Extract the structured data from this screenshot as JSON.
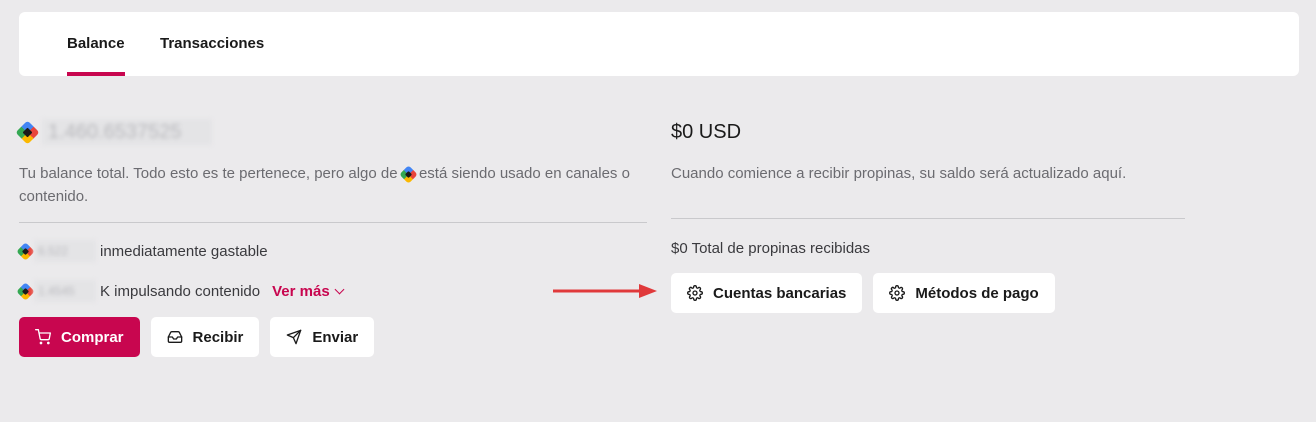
{
  "tabs": [
    {
      "label": "Balance",
      "active": true
    },
    {
      "label": "Transacciones",
      "active": false
    }
  ],
  "balance": {
    "amount": "1.460.6537525",
    "description_pre": "Tu balance total. Todo esto es te pertenece, pero algo de",
    "description_post": "está siendo usado en canales o contenido.",
    "spendable_amount": "6.522",
    "spendable_label": "inmediatamente gastable",
    "boosting_amount": "1.4545",
    "boosting_label": "K impulsando contenido",
    "ver_mas_label": "Ver más"
  },
  "actions": {
    "buy_label": "Comprar",
    "receive_label": "Recibir",
    "send_label": "Enviar"
  },
  "tips": {
    "amount": "$0 USD",
    "description": "Cuando comience a recibir propinas, su saldo será actualizado aquí.",
    "total_label": "$0 Total de propinas recibidas",
    "bank_accounts_label": "Cuentas bancarias",
    "payment_methods_label": "Métodos de pago"
  },
  "colors": {
    "accent": "#c8064f",
    "annotation_arrow": "#e0393b"
  }
}
